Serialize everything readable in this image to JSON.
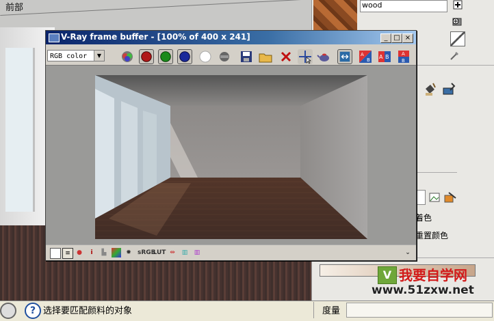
{
  "viewport": {
    "label": "前部"
  },
  "right_panel": {
    "material_name": "wood",
    "label_color": "着色",
    "label_reset_color": "重置颜色"
  },
  "watermark": {
    "logo_letter": "V",
    "site_name": "我要自学网",
    "site_url": "www.51zxw.net"
  },
  "status_bar": {
    "help_icon_glyph": "?",
    "message": "选择要匹配颜料的对象",
    "measure_label": "度量",
    "measure_value": ""
  },
  "vfb": {
    "title": "V-Ray frame buffer - [100% of 400 x 241]",
    "channel_selected": "RGB color",
    "toolbar_icons": [
      "rgb-channels-icon",
      "red-channel-icon",
      "green-channel-icon",
      "blue-channel-icon",
      "alpha-channel-icon",
      "mono-icon",
      "save-image-icon",
      "load-image-icon",
      "clear-image-icon",
      "track-mouse-icon",
      "teapot-render-icon",
      "lut-icon",
      "ab-compare-icon",
      "ab-horizontal-icon",
      "ab-vertical-icon"
    ],
    "bottom_icons_text": {
      "srgb": "sRGB",
      "lut": "LUT"
    },
    "colors": {
      "red_channel": "#b01818",
      "green_channel": "#1a8a1a",
      "blue_channel": "#1a2a9a",
      "titlebar": "#0a246a"
    }
  }
}
